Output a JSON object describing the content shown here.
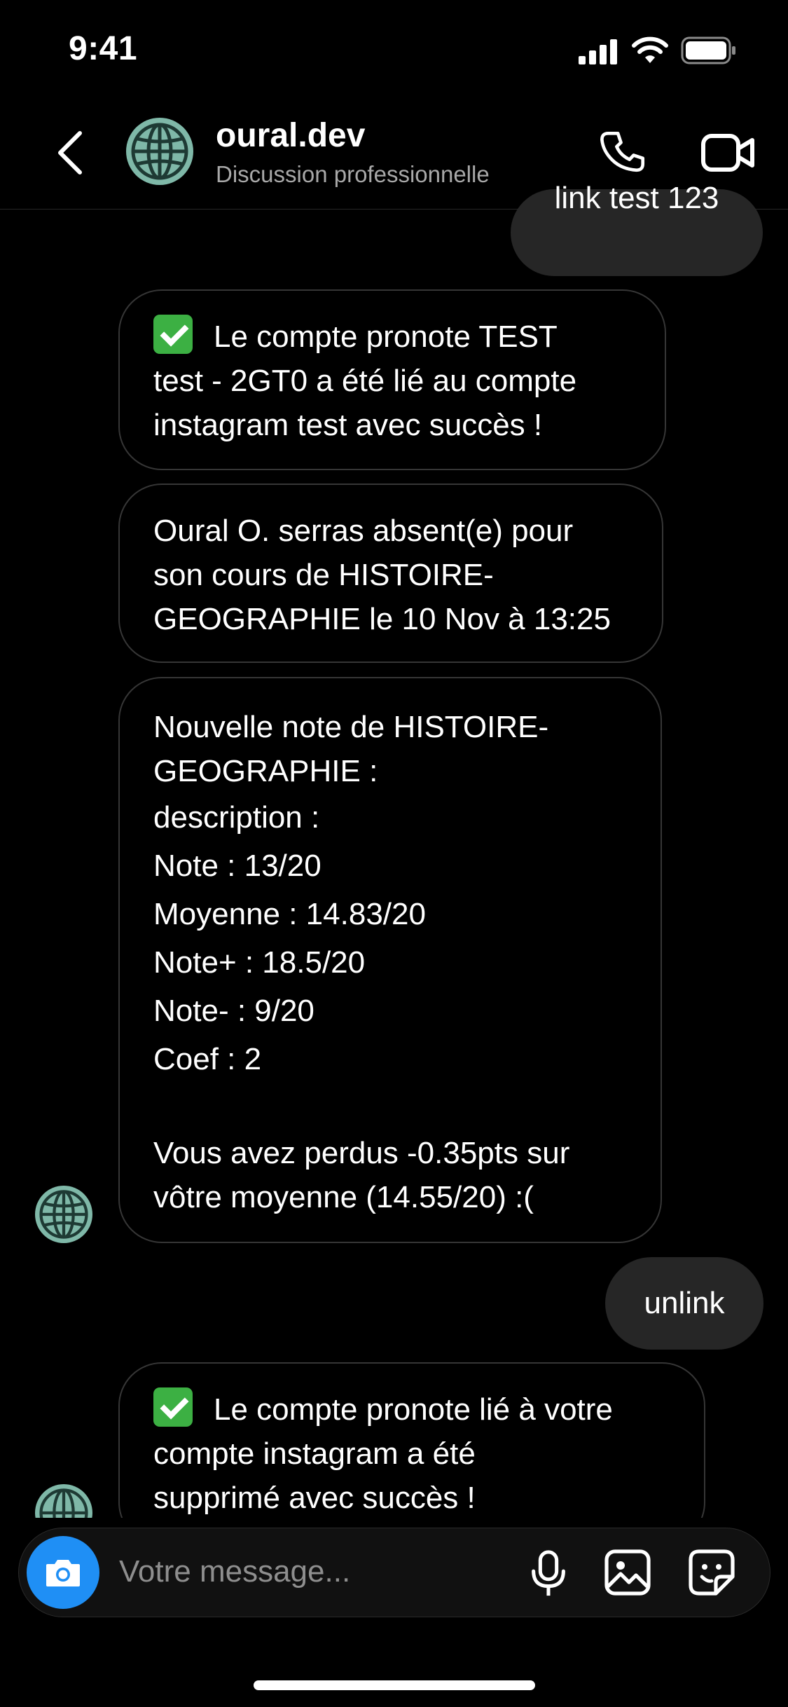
{
  "status_bar": {
    "time": "9:41"
  },
  "header": {
    "title": "oural.dev",
    "subtitle": "Discussion professionnelle"
  },
  "messages": {
    "out1": "link test 123",
    "in1": [
      "Le compte pronote TEST",
      "test - 2GT0 a été lié au compte",
      "instagram test avec succès !"
    ],
    "in2": [
      "Oural O. serras absent(e) pour",
      "son cours de HISTOIRE-",
      "GEOGRAPHIE le 10 Nov à 13:25"
    ],
    "in3": [
      "Nouvelle note de HISTOIRE-",
      "GEOGRAPHIE :",
      "description :",
      "Note : 13/20",
      "Moyenne : 14.83/20",
      "Note+ : 18.5/20",
      "Note- : 9/20",
      "Coef : 2",
      "Vous avez perdus -0.35pts sur",
      "vôtre moyenne (14.55/20) :("
    ],
    "out2": "unlink",
    "in4": [
      "Le compte pronote lié à votre",
      "compte instagram a été",
      "supprimé avec succès !"
    ]
  },
  "composer": {
    "placeholder": "Votre message..."
  },
  "icons": [
    "back-icon",
    "globe-avatar-icon",
    "phone-icon",
    "video-icon",
    "camera-icon",
    "microphone-icon",
    "gallery-icon",
    "sticker-icon",
    "checkmark-icon"
  ],
  "colors": {
    "background": "#000000",
    "outgoing_bubble": "#262626",
    "camera_button": "#1f8ff5",
    "avatar": "#7fb8a8",
    "check": "#3cb043"
  }
}
